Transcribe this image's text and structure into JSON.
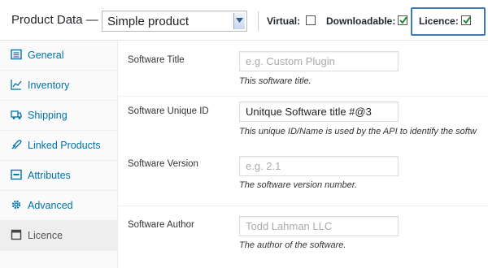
{
  "header": {
    "title": "Product Data —",
    "product_type": "Simple product",
    "virtual_label": "Virtual:",
    "virtual_checked": false,
    "downloadable_label": "Downloadable:",
    "downloadable_checked": true,
    "licence_label": "Licence:",
    "licence_checked": true
  },
  "sidebar": {
    "items": [
      {
        "label": "General",
        "icon": "general-icon"
      },
      {
        "label": "Inventory",
        "icon": "inventory-icon"
      },
      {
        "label": "Shipping",
        "icon": "shipping-icon"
      },
      {
        "label": "Linked Products",
        "icon": "link-icon"
      },
      {
        "label": "Attributes",
        "icon": "attributes-icon"
      },
      {
        "label": "Advanced",
        "icon": "gear-icon"
      },
      {
        "label": "Licence",
        "icon": "licence-icon",
        "active": true
      }
    ]
  },
  "fields": [
    {
      "label": "Software Title",
      "placeholder": "e.g. Custom Plugin",
      "value": "",
      "description": "This software title."
    },
    {
      "label": "Software Unique ID",
      "placeholder": "",
      "value": "Unitque Software title #@3",
      "description": "This unique ID/Name is used by the API to identify the softw"
    },
    {
      "label": "Software Version",
      "placeholder": "e.g. 2.1",
      "value": "",
      "description": "The software version number."
    },
    {
      "label": "Software Author",
      "placeholder": "Todd Lahman LLC",
      "value": "",
      "description": "The author of the software."
    }
  ],
  "colors": {
    "link": "#0073aa",
    "accent_border": "#3a7bbf",
    "check": "#1e8c3a"
  }
}
